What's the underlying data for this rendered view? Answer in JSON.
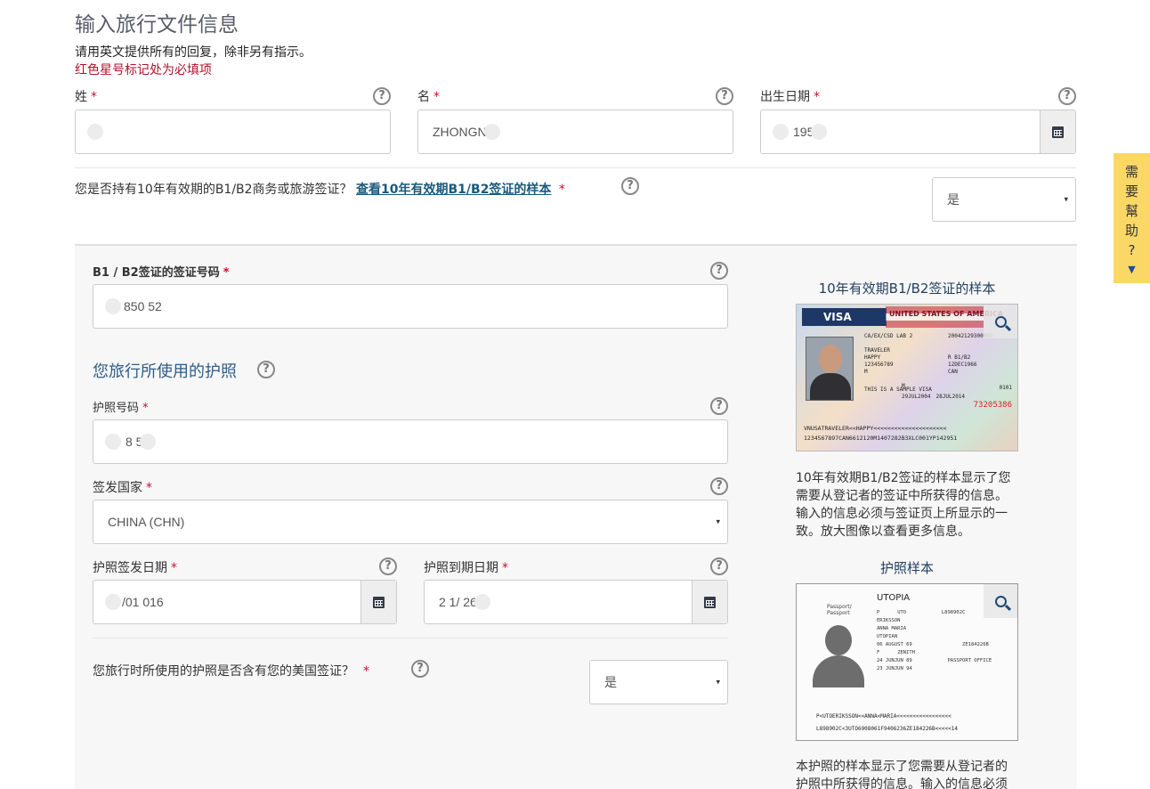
{
  "page": {
    "title": "输入旅行文件信息",
    "intro": "请用英文提供所有的回复，除非另有指示。",
    "required_note": "红色星号标记处为必填项"
  },
  "fields": {
    "surname": {
      "label": "姓",
      "value": ""
    },
    "given_name": {
      "label": "名",
      "value": "ZHONGN"
    },
    "dob": {
      "label": "出生日期",
      "value": "195"
    },
    "ten_year_visa_question": "您是否持有10年有效期的B1/B2商务或旅游签证？",
    "ten_year_visa_link": "查看10年有效期B1/B2签证的样本",
    "ten_year_visa_answer": "是",
    "visa_number": {
      "label": "B1 / B2签证的签证号码",
      "value": "850 52"
    },
    "passport_section_title": "您旅行所使用的护照",
    "passport_number": {
      "label": "护照号码",
      "value": "8 5"
    },
    "issuing_country": {
      "label": "签发国家",
      "value": "CHINA (CHN)"
    },
    "issue_date": {
      "label": "护照签发日期",
      "value": "/01 016"
    },
    "expiry_date": {
      "label": "护照到期日期",
      "value": "2 1/ 26"
    },
    "passport_has_visa_question": "您旅行时所使用的护照是否含有您的美国签证？",
    "passport_has_visa_answer": "是"
  },
  "sidebar": {
    "visa_sample_title": "10年有效期B1/B2签证的样本",
    "visa_sample_desc": "10年有效期B1/B2签证的样本显示了您需要从登记者的签证中所获得的信息。输入的信息必须与签证页上所显示的一致。放大图像以查看更多信息。",
    "passport_sample_title": "护照样本",
    "passport_sample_desc": "本护照的样本显示了您需要从登记者的护照中所获得的信息。输入的信息必须"
  },
  "visa_sample": {
    "visa_word": "VISA",
    "header": "UNITED STATES OF AMERICA",
    "post": "CA/EX/CSD LAB 2",
    "control_no": "20042129300001",
    "surname": "TRAVELER",
    "given": "HAPPY",
    "passport_no": "123456789",
    "visa_type": "R   B1/B2",
    "sex": "M",
    "birth": "12DEC1966",
    "nationality": "CAN",
    "entries": "M",
    "issue": "29JUL2004",
    "expiry": "28JUL2014",
    "annotation": "THIS IS A SAMPLE VISA",
    "red_no": "73205386",
    "num_0101": "0101",
    "mrz1": "VNUSATRAVELER<<HAPPY<<<<<<<<<<<<<<<<<<<<<",
    "mrz2": "1234567897CAN6612120M1407282B3XLC001YP142951"
  },
  "passport_sample": {
    "country": "UTOPIA",
    "passport_label": "Passport/\nPassport",
    "type": "P",
    "code": "UTO",
    "number": "L898902C",
    "surname": "ERIKSSON",
    "given": "ANNA MARIA",
    "nationality": "UTOPIAN",
    "dob": "06 AUGUST 69",
    "personal_no": "ZE184226B",
    "sex": "F",
    "place": "ZENITH",
    "issue": "24 JUNJUN 89",
    "authority": "PASSPORT OFFICE",
    "expiry": "23 JUNJUN 94",
    "mrz1": "P<UTOERIKSSON<<ANNA<MARIA<<<<<<<<<<<<<<<<<",
    "mrz2": "L898902C<3UTO6908061F9406236ZE184226B<<<<<14"
  },
  "help_tab": {
    "chars": [
      "需",
      "要",
      "幫",
      "助",
      "?"
    ],
    "arrow": "▼"
  },
  "common": {
    "star": "*",
    "help_glyph": "?",
    "select_arrow": "▾"
  }
}
